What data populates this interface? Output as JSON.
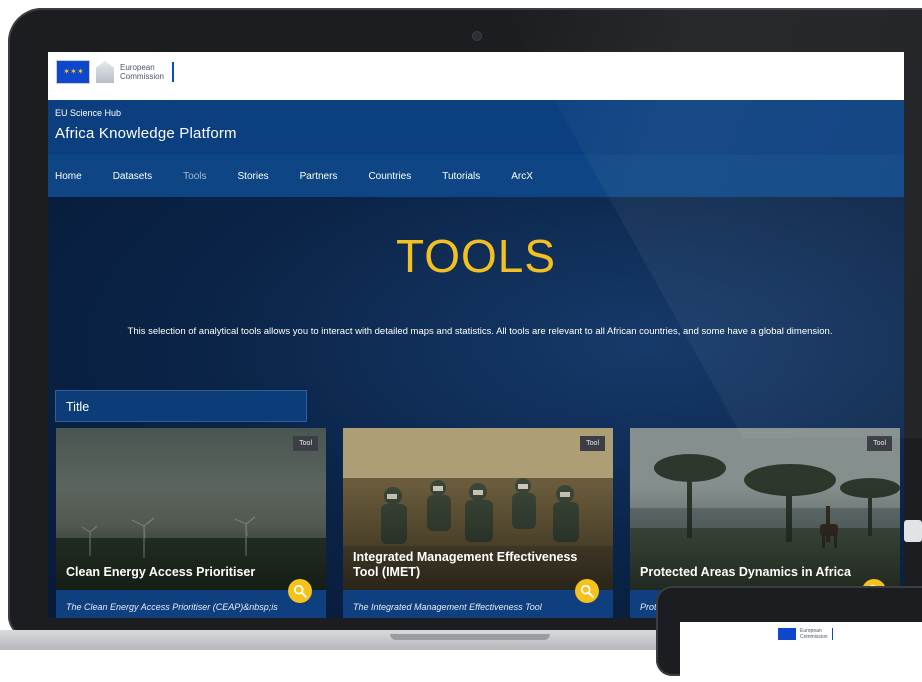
{
  "branding": {
    "org_line1": "European",
    "org_line2": "Commission",
    "hub": "EU Science Hub",
    "platform": "Africa Knowledge Platform"
  },
  "nav": {
    "items": [
      {
        "label": "Home",
        "active": false
      },
      {
        "label": "Datasets",
        "active": false
      },
      {
        "label": "Tools",
        "active": true
      },
      {
        "label": "Stories",
        "active": false
      },
      {
        "label": "Partners",
        "active": false
      },
      {
        "label": "Countries",
        "active": false
      },
      {
        "label": "Tutorials",
        "active": false
      },
      {
        "label": "ArcX",
        "active": false
      }
    ]
  },
  "hero": {
    "title": "TOOLS",
    "description": "This selection of analytical tools allows you to interact with detailed maps and statistics. All tools are relevant to all African countries, and some have a global dimension."
  },
  "filter": {
    "label": "Title"
  },
  "cards": [
    {
      "badge": "Tool",
      "title": "Clean Energy Access Prioritiser",
      "description": "The Clean Energy Access Prioritiser (CEAP)&nbsp;is",
      "image": "wind-turbines-haze"
    },
    {
      "badge": "Tool",
      "title": "Integrated Management Effectiveness Tool (IMET)",
      "description": "The Integrated Management Effectiveness Tool",
      "image": "workshop-classroom"
    },
    {
      "badge": "Tool",
      "title": "Protected Areas Dynamics in Africa",
      "description": "Prote",
      "image": "acacia-savanna-giraffe"
    }
  ],
  "tablet": {
    "org_line1": "European",
    "org_line2": "Commission"
  },
  "colors": {
    "accent": "#f2c121",
    "header_blue": "#0c3f80",
    "page_bg": "#0a2346",
    "search_button": "#f5c21b"
  }
}
